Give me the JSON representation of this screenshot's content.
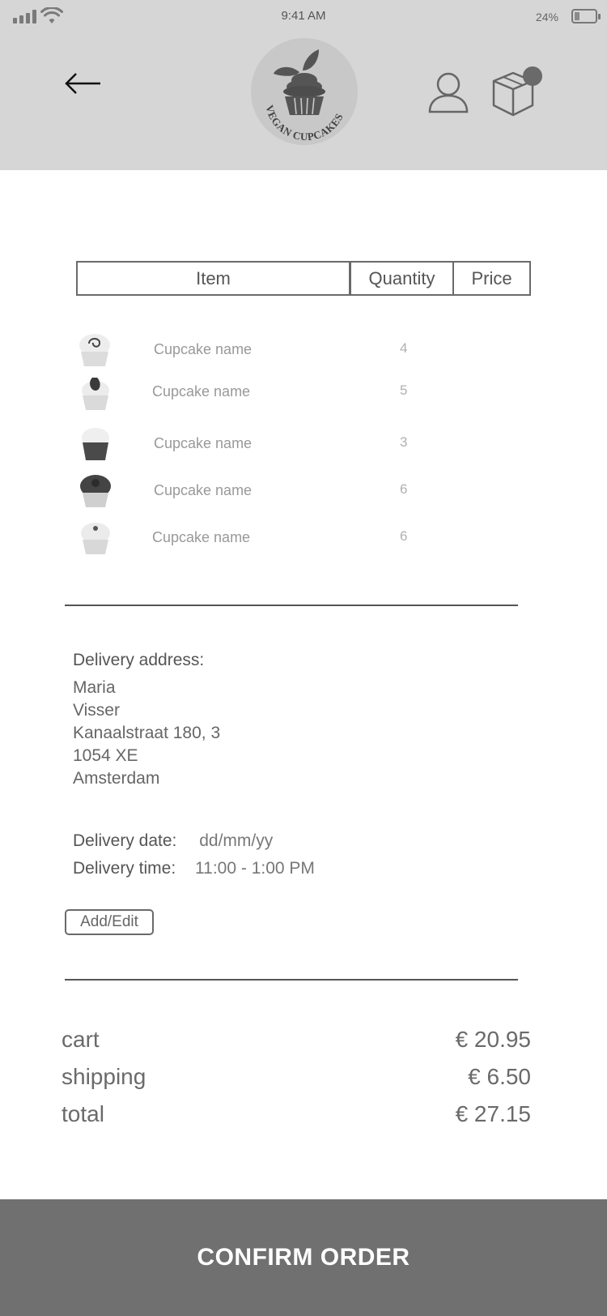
{
  "status_bar": {
    "time": "9:41 AM",
    "battery_percent": "24%",
    "battery_level": 0.24,
    "icons": [
      "signal-icon",
      "wifi-icon",
      "battery-icon"
    ]
  },
  "header": {
    "logo_text": "VEGAN CUPCAKES",
    "icons": [
      "back-arrow-icon",
      "user-icon",
      "box-cart-icon"
    ]
  },
  "table": {
    "columns": [
      "Item",
      "Quantity",
      "Price"
    ],
    "rows": [
      {
        "name": "Cupcake name",
        "qty": "4"
      },
      {
        "name": "Cupcake name",
        "qty": "5"
      },
      {
        "name": "Cupcake name",
        "qty": "3"
      },
      {
        "name": "Cupcake name",
        "qty": "6"
      },
      {
        "name": "Cupcake name",
        "qty": "6"
      }
    ]
  },
  "delivery": {
    "address_label": "Delivery address:",
    "address_lines": [
      "Maria",
      "Visser",
      "Kanaalstraat 180, 3",
      "1054 XE",
      "Amsterdam"
    ],
    "date_label": "Delivery date:",
    "date_value": "dd/mm/yy",
    "time_label": "Delivery time:",
    "time_value": "11:00 - 1:00 PM",
    "edit_button": "Add/Edit"
  },
  "summary": {
    "cart_label": "cart",
    "cart_value": "€ 20.95",
    "shipping_label": "shipping",
    "shipping_value": "€ 6.50",
    "total_label": "total",
    "total_value": "€ 27.15"
  },
  "confirm_button": "CONFIRM ORDER",
  "colors": {
    "header_bg": "#d6d6d6",
    "confirm_bg": "#707070"
  }
}
